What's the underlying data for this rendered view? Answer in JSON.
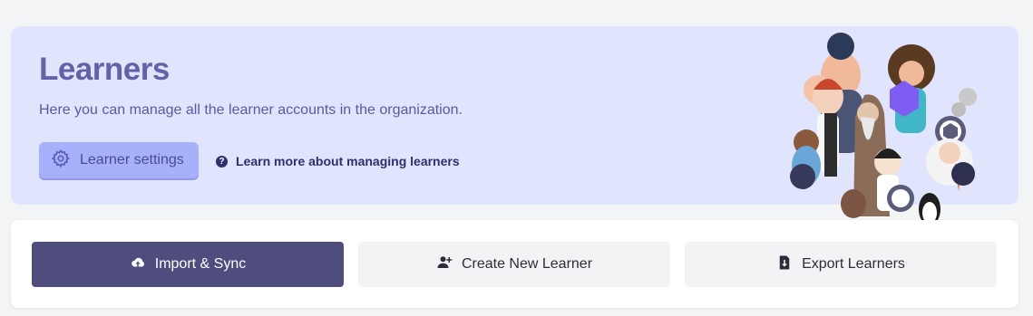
{
  "hero": {
    "title": "Learners",
    "description": "Here you can manage all the learner accounts in the organization.",
    "settings_button": "Learner settings",
    "learn_more_link": "Learn more about managing learners",
    "help_glyph": "?"
  },
  "actions": {
    "import_sync": "Import & Sync",
    "create_learner": "Create New Learner",
    "export_learners": "Export Learners"
  },
  "icons": {
    "settings": "gear-icon",
    "help": "question-circle-icon",
    "import": "cloud-upload-icon",
    "create": "user-plus-icon",
    "export": "file-download-icon"
  },
  "colors": {
    "hero_bg": "#e0e5fd",
    "title": "#6461a8",
    "primary_button": "#4f4c7e",
    "secondary_button": "#f2f3f5"
  }
}
